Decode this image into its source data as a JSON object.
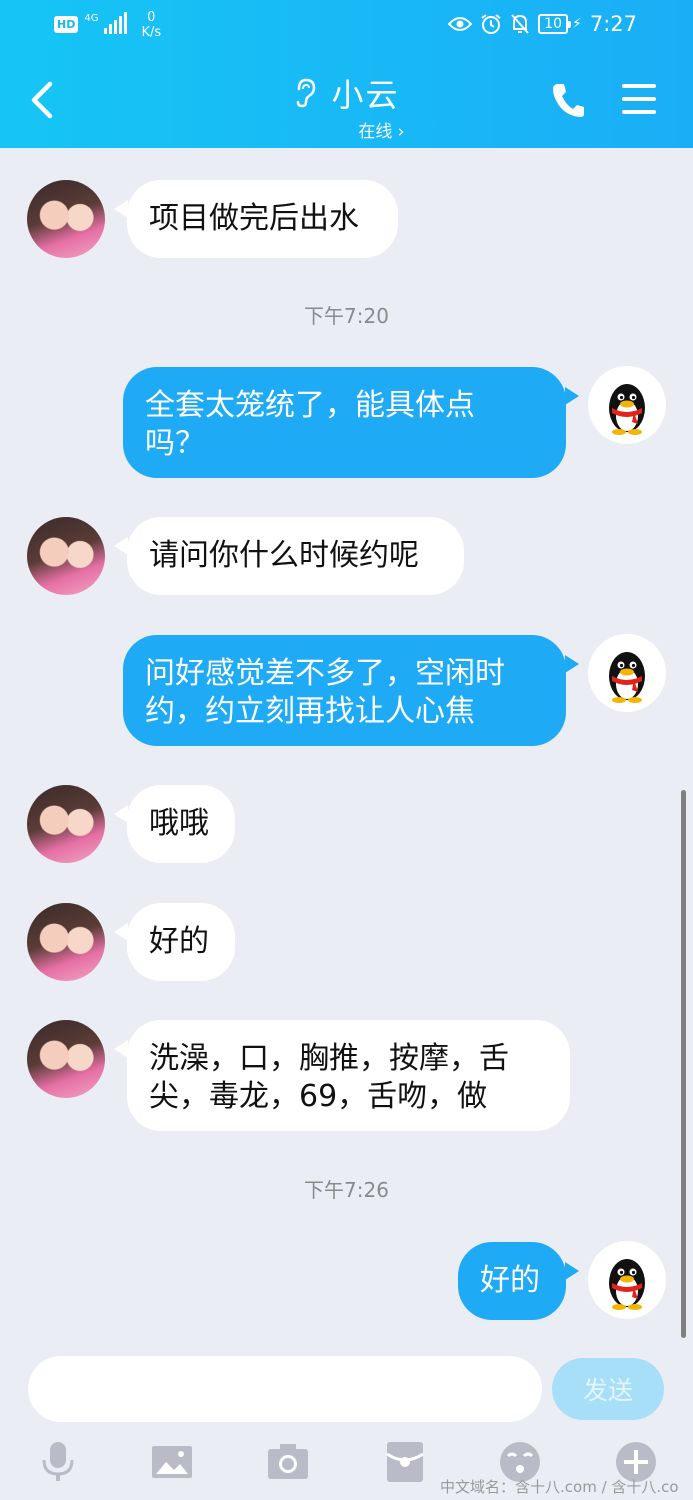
{
  "status_bar": {
    "hd": "HD",
    "network": "4G",
    "speed_value": "0",
    "speed_unit": "K/s",
    "battery": "10",
    "time": "7:27"
  },
  "header": {
    "title": "小云",
    "subtitle": "在线 ›",
    "colors": {
      "gradient_start": "#16c5f5",
      "gradient_end": "#1aaef6"
    }
  },
  "messages": [
    {
      "from": "other",
      "text": "项目做完后出水"
    },
    {
      "timestamp": "下午7:20"
    },
    {
      "from": "self",
      "text": "全套太笼统了，能具体点吗？"
    },
    {
      "from": "other",
      "text": "请问你什么时候约呢"
    },
    {
      "from": "self",
      "text": "问好感觉差不多了，空闲时约，约立刻再找让人心焦"
    },
    {
      "from": "other",
      "text": "哦哦"
    },
    {
      "from": "other",
      "text": "好的"
    },
    {
      "from": "other",
      "text": "洗澡，口，胸推，按摩，舌尖，毒龙，69，舌吻，做"
    },
    {
      "timestamp": "下午7:26"
    },
    {
      "from": "self",
      "text": "好的"
    }
  ],
  "bubble_lines": {
    "m2_l1": "全套太笼统了，能具体点",
    "m2_l2": "吗？",
    "m4_l1": "问好感觉差不多了，空闲时",
    "m4_l2": "约，约立刻再找让人心焦",
    "m7_l1": "洗澡，口，胸推，按摩，舌",
    "m7_l2": "尖，毒龙，69，舌吻，做"
  },
  "input": {
    "value": "",
    "send_label": "发送"
  },
  "toolbar": [
    "mic-icon",
    "image-icon",
    "camera-icon",
    "red-envelope-icon",
    "emoji-icon",
    "plus-icon"
  ],
  "watermark": "中文域名：含十八.com / 含十八.co",
  "colors": {
    "outgoing_bubble": "#1faaf5",
    "incoming_bubble": "#ffffff",
    "background": "#ebedf5",
    "send_button": "#a7def8"
  }
}
